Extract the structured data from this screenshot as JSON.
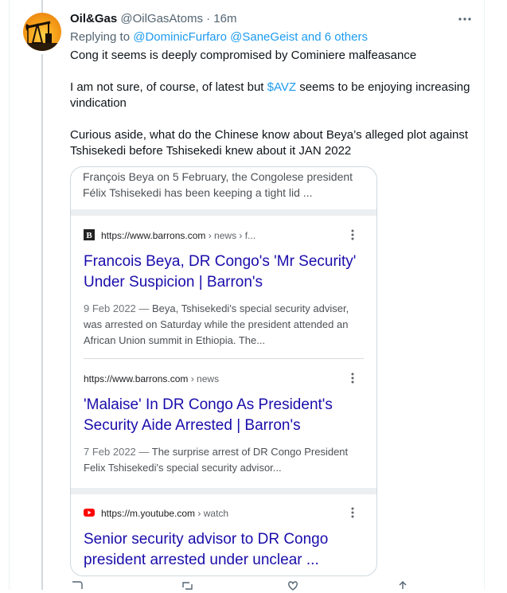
{
  "tweet": {
    "display_name": "Oil&Gas",
    "handle": "@OilGasAtoms",
    "separator": "·",
    "time": "16m",
    "more_icon": "more-horizontal-icon",
    "replying_prefix": "Replying to ",
    "replying_users": "@DominicFurfaro @SaneGeist",
    "replying_others": " and 6 others",
    "paragraph_1": "Cong it seems is deeply compromised by Cominiere malfeasance",
    "paragraph_2_before": "I am not sure, of course, of latest but ",
    "paragraph_2_cashtag": "$AVZ",
    "paragraph_2_after": " seems to be enjoying increasing vindication",
    "paragraph_3": "Curious aside, what do the Chinese know about Beya’s alleged plot against Tshisekedi before Tshisekedi knew about it JAN 2022"
  },
  "screenshot": {
    "top_snippet": "François Beya on 5 February, the Congolese president Félix Tshisekedi has been keeping a tight lid ...",
    "results": [
      {
        "favicon": "barrons-favicon",
        "domain": "https://www.barrons.com",
        "path": " › news › f...",
        "title": "Francois Beya, DR Congo's 'Mr Security' Under Suspicion | Barron's",
        "date": "9 Feb 2022 — ",
        "snippet": "Beya, Tshisekedi's special security adviser, was arrested on Saturday while the president attended an African Union summit in Ethiopia. The..."
      },
      {
        "favicon": "",
        "domain": "https://www.barrons.com",
        "path": " › news",
        "title": "'Malaise' In DR Congo As President's Security Aide Arrested | Barron's",
        "date": "7 Feb 2022 — ",
        "snippet": "The surprise arrest of DR Congo President Felix Tshisekedi's special security advisor..."
      },
      {
        "favicon": "youtube-favicon",
        "domain": "https://m.youtube.com",
        "path": " › watch",
        "title": "Senior security advisor to DR Congo president arrested under unclear ...",
        "date": "",
        "snippet": ""
      }
    ]
  },
  "colors": {
    "link": "#1d9bf0",
    "google_title": "#1a0dab",
    "youtube_red": "#ff0000"
  }
}
